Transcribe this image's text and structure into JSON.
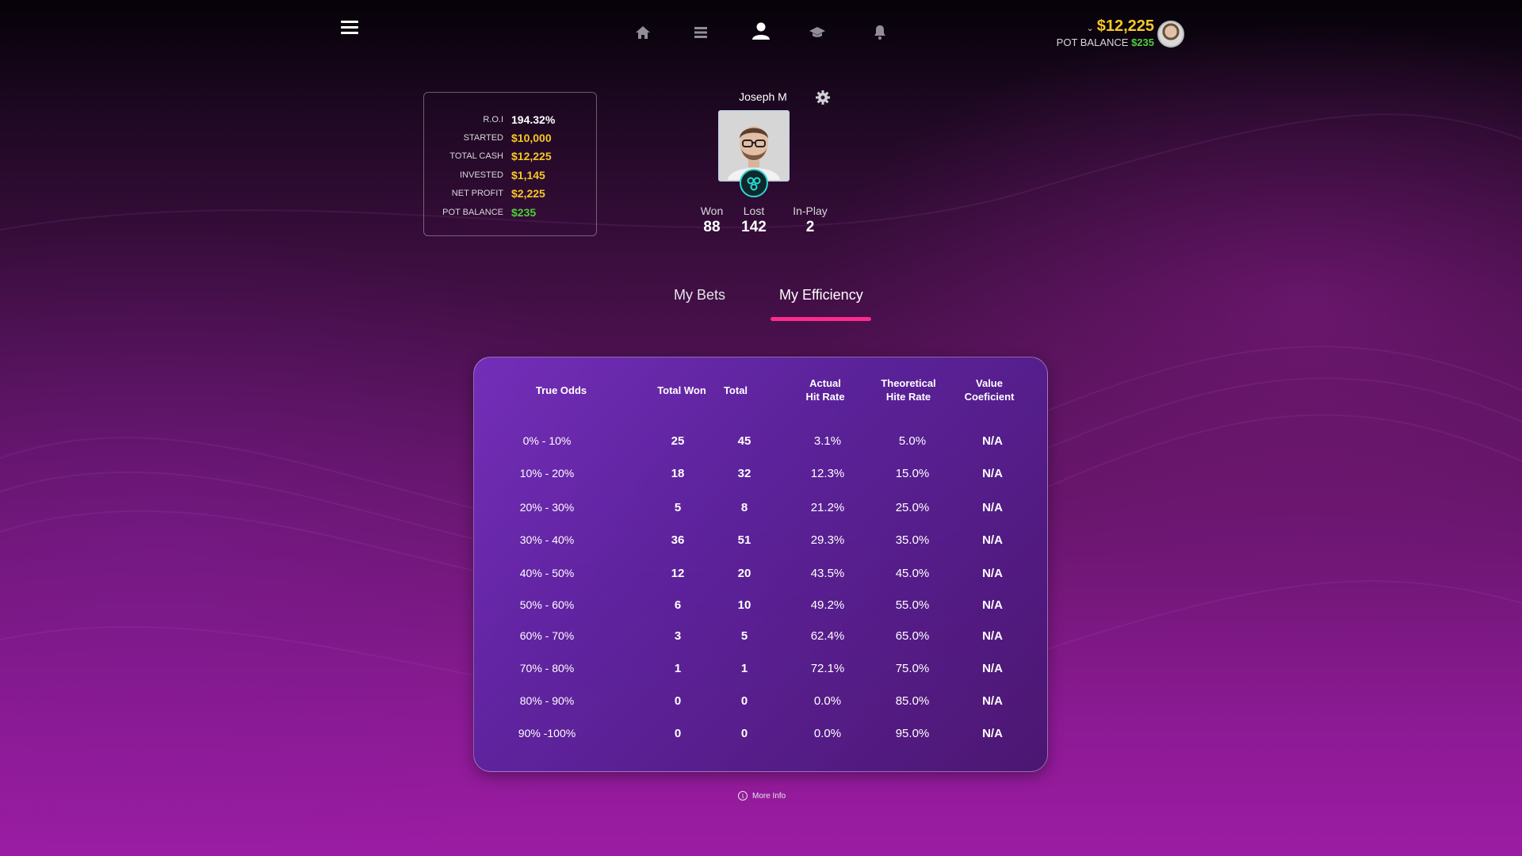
{
  "header": {
    "balance": "$12,225",
    "pot_label": "POT BALANCE",
    "pot_value": "$235"
  },
  "nav": {
    "items": [
      {
        "icon": "home-icon",
        "active": false
      },
      {
        "icon": "list-icon",
        "active": false
      },
      {
        "icon": "user-icon",
        "active": true
      },
      {
        "icon": "graduation-cap-icon",
        "active": false
      },
      {
        "icon": "bell-icon",
        "active": false
      }
    ]
  },
  "stats": {
    "rows": [
      {
        "label": "R.O.I",
        "value": "194.32%",
        "color": "#ffffff"
      },
      {
        "label": "STARTED",
        "value": "$10,000",
        "color": "#f5c825"
      },
      {
        "label": "TOTAL CASH",
        "value": "$12,225",
        "color": "#f5c825"
      },
      {
        "label": "INVESTED",
        "value": "$1,145",
        "color": "#f5c825"
      },
      {
        "label": "NET PROFIT",
        "value": "$2,225",
        "color": "#f5c825"
      },
      {
        "label": "POT BALANCE",
        "value": "$235",
        "color": "#4cd137"
      }
    ]
  },
  "profile": {
    "name": "Joseph M",
    "won_label": "Won",
    "won": "88",
    "lost_label": "Lost",
    "lost": "142",
    "inplay_label": "In-Play",
    "inplay": "2"
  },
  "tabs": {
    "bets": "My Bets",
    "efficiency": "My Efficiency"
  },
  "table": {
    "headers": {
      "true_odds": "True Odds",
      "total_won": "Total Won",
      "total": "Total",
      "actual_1": "Actual",
      "actual_2": "Hit Rate",
      "theoretical_1": "Theoretical",
      "theoretical_2": "Hite Rate",
      "value_1": "Value",
      "value_2": "Coeficient"
    },
    "rows": [
      {
        "range": "0% - 10%",
        "won": "25",
        "total": "45",
        "actual": "3.1%",
        "theoretical": "5.0%",
        "value": "N/A"
      },
      {
        "range": "10% - 20%",
        "won": "18",
        "total": "32",
        "actual": "12.3%",
        "theoretical": "15.0%",
        "value": "N/A"
      },
      {
        "range": "20% - 30%",
        "won": "5",
        "total": "8",
        "actual": "21.2%",
        "theoretical": "25.0%",
        "value": "N/A"
      },
      {
        "range": "30% - 40%",
        "won": "36",
        "total": "51",
        "actual": "29.3%",
        "theoretical": "35.0%",
        "value": "N/A"
      },
      {
        "range": "40% - 50%",
        "won": "12",
        "total": "20",
        "actual": "43.5%",
        "theoretical": "45.0%",
        "value": "N/A"
      },
      {
        "range": "50% - 60%",
        "won": "6",
        "total": "10",
        "actual": "49.2%",
        "theoretical": "55.0%",
        "value": "N/A"
      },
      {
        "range": "60% - 70%",
        "won": "3",
        "total": "5",
        "actual": "62.4%",
        "theoretical": "65.0%",
        "value": "N/A"
      },
      {
        "range": "70% - 80%",
        "won": "1",
        "total": "1",
        "actual": "72.1%",
        "theoretical": "75.0%",
        "value": "N/A"
      },
      {
        "range": "80% - 90%",
        "won": "0",
        "total": "0",
        "actual": "0.0%",
        "theoretical": "85.0%",
        "value": "N/A"
      },
      {
        "range": "90% -100%",
        "won": "0",
        "total": "0",
        "actual": "0.0%",
        "theoretical": "95.0%",
        "value": "N/A"
      }
    ]
  },
  "footer": {
    "more_info": "More Info"
  }
}
